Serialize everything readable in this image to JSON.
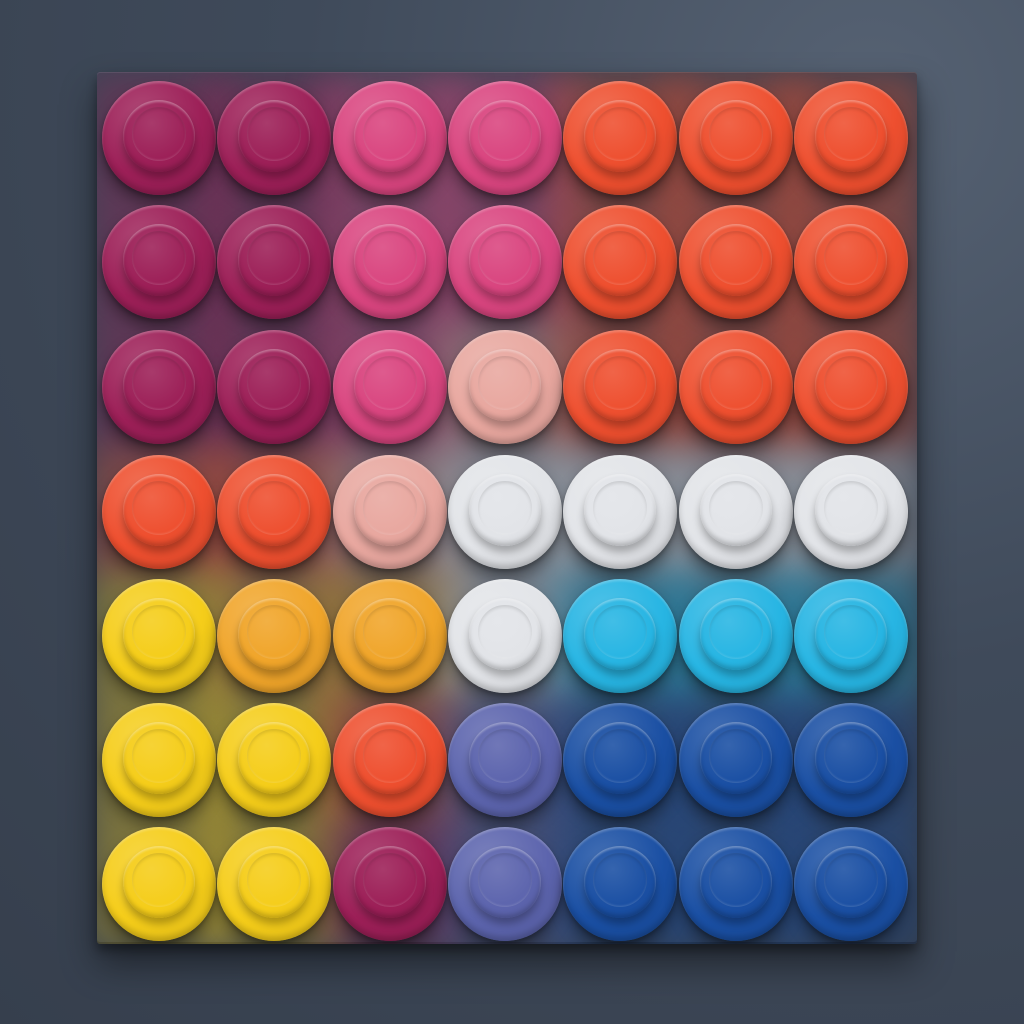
{
  "scene": {
    "background_color": "#3f4a5a",
    "board_color": "#3a4453"
  },
  "grid": {
    "rows": 7,
    "cols": 7,
    "palette": {
      "magenta": "#9c1f57",
      "pink": "#d9457f",
      "orange": "#ee4f2f",
      "peach": "#e8a79f",
      "white": "#e2e4e8",
      "yellow": "#f5cd1a",
      "amber": "#f0a52a",
      "cyan": "#27b5e3",
      "periwinkle": "#5c64ad",
      "blue": "#1a4fa3"
    },
    "buttons": [
      [
        "magenta",
        "magenta",
        "pink",
        "pink",
        "orange",
        "orange",
        "orange"
      ],
      [
        "magenta",
        "magenta",
        "pink",
        "pink",
        "orange",
        "orange",
        "orange"
      ],
      [
        "magenta",
        "magenta",
        "pink",
        "peach",
        "orange",
        "orange",
        "orange"
      ],
      [
        "orange",
        "orange",
        "peach",
        "white",
        "white",
        "white",
        "white"
      ],
      [
        "yellow",
        "amber",
        "amber",
        "white",
        "cyan",
        "cyan",
        "cyan"
      ],
      [
        "yellow",
        "yellow",
        "orange",
        "periwinkle",
        "blue",
        "blue",
        "blue"
      ],
      [
        "yellow",
        "yellow",
        "magenta",
        "periwinkle",
        "blue",
        "blue",
        "blue"
      ]
    ]
  }
}
